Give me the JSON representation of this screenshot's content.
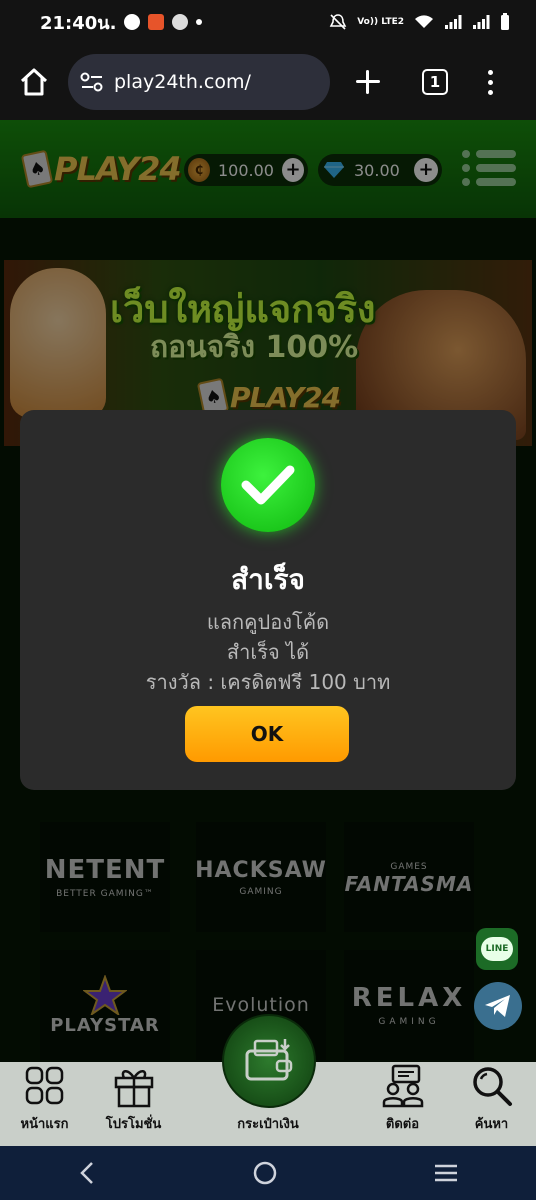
{
  "status_bar": {
    "time": "21:40น.",
    "right_text": "Vo)) LTE2"
  },
  "browser": {
    "url": "play24th.com/",
    "tab_count": "1"
  },
  "header": {
    "logo_text": "PLAY24",
    "coins_value": "100.00",
    "gems_value": "30.00"
  },
  "banner": {
    "headline_1": "เว็บใหญ่แจกจริง",
    "headline_2": "ถอนจริง 100%",
    "logo_text": "PLAY24"
  },
  "modal": {
    "title": "สำเร็จ",
    "line_1": "แลกคูปองโค้ด",
    "line_2": "สำเร็จ ได้",
    "line_3": "รางวัล : เครดิตฟรี 100 บาท",
    "ok_label": "OK"
  },
  "providers": [
    {
      "name": "NETENT",
      "sub": "BETTER GAMING™"
    },
    {
      "name": "HACKSAW",
      "sub": "GAMING"
    },
    {
      "name": "FANTASMA",
      "sub": "GAMES"
    },
    {
      "name": "PLAYSTAR",
      "sub": ""
    },
    {
      "name": "Evolution",
      "sub": ""
    },
    {
      "name": "RELAX",
      "sub": "GAMING"
    }
  ],
  "side_buttons": {
    "line_label": "LINE"
  },
  "bottom_nav": [
    {
      "label": "หน้าแรก",
      "icon": "home-grid-icon"
    },
    {
      "label": "โปรโมชั่น",
      "icon": "gift-icon"
    },
    {
      "label": "กระเป๋าเงิน",
      "icon": "wallet-icon"
    },
    {
      "label": "ติดต่อ",
      "icon": "contact-icon"
    },
    {
      "label": "ค้นหา",
      "icon": "search-icon"
    }
  ],
  "colors": {
    "header_green": "#1a8f0f",
    "modal_bg": "#2b2b2b",
    "ok_button": "#ffb000",
    "success_green": "#1fd41f"
  }
}
